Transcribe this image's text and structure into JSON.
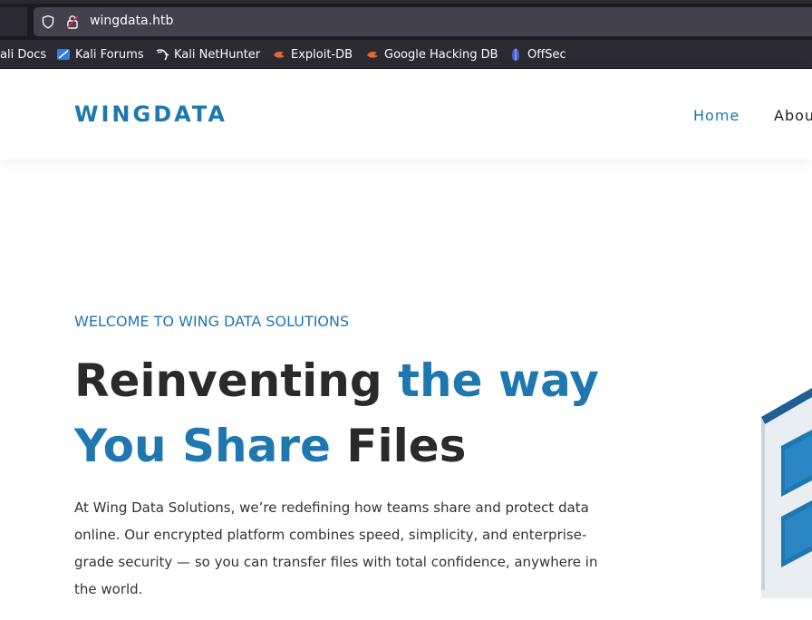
{
  "browser": {
    "url": "wingdata.htb",
    "bookmarks": [
      {
        "label": "ali Docs",
        "icon": "kali-docs-icon"
      },
      {
        "label": "Kali Forums",
        "icon": "kali-forums-icon"
      },
      {
        "label": "Kali NetHunter",
        "icon": "kali-nethunter-icon"
      },
      {
        "label": "Exploit-DB",
        "icon": "exploit-db-icon"
      },
      {
        "label": "Google Hacking DB",
        "icon": "ghdb-icon"
      },
      {
        "label": "OffSec",
        "icon": "offsec-icon"
      }
    ]
  },
  "header": {
    "logo": "WINGDATA",
    "nav": {
      "home": "Home",
      "about": "Abou"
    }
  },
  "hero": {
    "eyebrow": "WELCOME TO WING DATA SOLUTIONS",
    "headline": {
      "line1_dark": "Reinventing ",
      "line1_accent": "the way",
      "line2_accent": "You Share",
      "line2_dark": " Files"
    },
    "lede": "At Wing Data Solutions, we’re redefining how teams share and protect data online. Our encrypted platform combines speed, simplicity, and enterprise-grade security — so you can transfer files with total confidence, anywhere in the world."
  },
  "colors": {
    "accent": "#1f77b0",
    "dark_text": "#2a2a2a",
    "chrome_bg": "#1c1b22",
    "urlbar_bg": "#42414d"
  }
}
